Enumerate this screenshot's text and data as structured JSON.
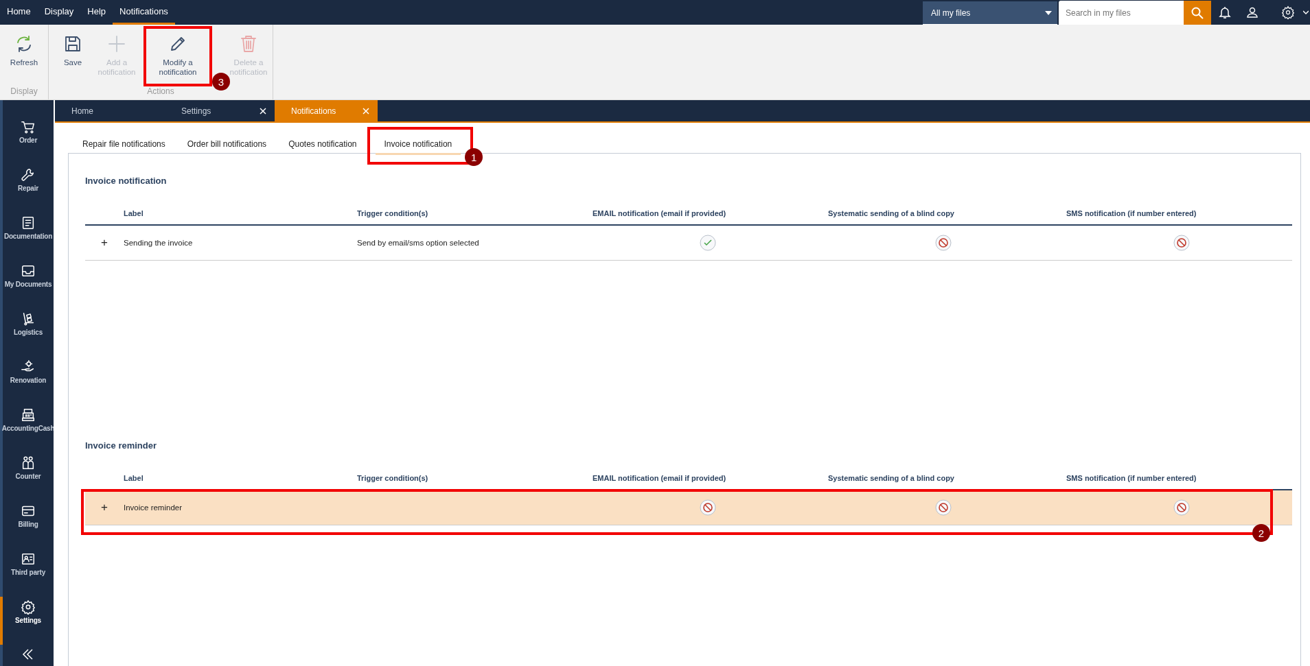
{
  "menu_bar": {
    "items": [
      {
        "label": "Home",
        "selected": false
      },
      {
        "label": "Display",
        "selected": false
      },
      {
        "label": "Help",
        "selected": false
      },
      {
        "label": "Notifications",
        "selected": true
      }
    ],
    "scope_dropdown": {
      "value": "All my files"
    },
    "search": {
      "placeholder": "Search in my files"
    }
  },
  "ribbon": {
    "groups": [
      {
        "label": "Display",
        "buttons": [
          {
            "label": "Refresh",
            "kind": "refresh",
            "disabled": false
          }
        ]
      },
      {
        "label": "Actions",
        "buttons": [
          {
            "label": "Save",
            "kind": "save",
            "disabled": false
          },
          {
            "label": "Add a notification",
            "kind": "add",
            "disabled": true
          },
          {
            "label": "Modify a notification",
            "kind": "edit",
            "disabled": false,
            "annotation": "3"
          },
          {
            "label": "Delete a notification",
            "kind": "delete",
            "disabled": true
          }
        ]
      }
    ]
  },
  "document_tabs": [
    {
      "label": "Home",
      "selected": false,
      "closable": false
    },
    {
      "label": "Settings",
      "selected": false,
      "closable": true
    },
    {
      "label": "Notifications",
      "selected": true,
      "closable": true
    }
  ],
  "sidebar": {
    "items": [
      {
        "label": "Order",
        "kind": "cart",
        "selected": false
      },
      {
        "label": "Repair",
        "kind": "wrench",
        "selected": false
      },
      {
        "label": "Documentation",
        "kind": "document",
        "selected": false
      },
      {
        "label": "My Documents",
        "kind": "tray",
        "selected": false
      },
      {
        "label": "Logistics",
        "kind": "trolley",
        "selected": false
      },
      {
        "label": "Renovation",
        "kind": "hand",
        "selected": false
      },
      {
        "label": "AccountingCash",
        "kind": "register",
        "selected": false
      },
      {
        "label": "Counter",
        "kind": "people",
        "selected": false
      },
      {
        "label": "Billing",
        "kind": "card",
        "selected": false
      },
      {
        "label": "Third party",
        "kind": "idcard",
        "selected": false
      },
      {
        "label": "Settings",
        "kind": "gear",
        "selected": true
      }
    ]
  },
  "notification_tabs": [
    {
      "label": "Repair file notifications",
      "selected": false
    },
    {
      "label": "Order bill notifications",
      "selected": false
    },
    {
      "label": "Quotes notification",
      "selected": false
    },
    {
      "label": "Invoice notification",
      "selected": true,
      "annotation": "1"
    }
  ],
  "sections": [
    {
      "title": "Invoice notification",
      "columns": [
        "Label",
        "Trigger condition(s)",
        "EMAIL notification (email if provided)",
        "Systematic sending of a blind copy",
        "SMS notification (if number entered)"
      ],
      "rows": [
        {
          "expand": "+",
          "label": "Sending the invoice",
          "trigger": "Send by email/sms option selected",
          "email": true,
          "blind_copy": false,
          "sms": false,
          "selected": false
        }
      ]
    },
    {
      "title": "Invoice reminder",
      "columns": [
        "Label",
        "Trigger condition(s)",
        "EMAIL notification (email if provided)",
        "Systematic sending of a blind copy",
        "SMS notification (if number entered)"
      ],
      "rows": [
        {
          "expand": "+",
          "label": "Invoice reminder",
          "email": false,
          "blind_copy": false,
          "sms": false,
          "selected": true,
          "annotation": "2"
        }
      ]
    }
  ]
}
